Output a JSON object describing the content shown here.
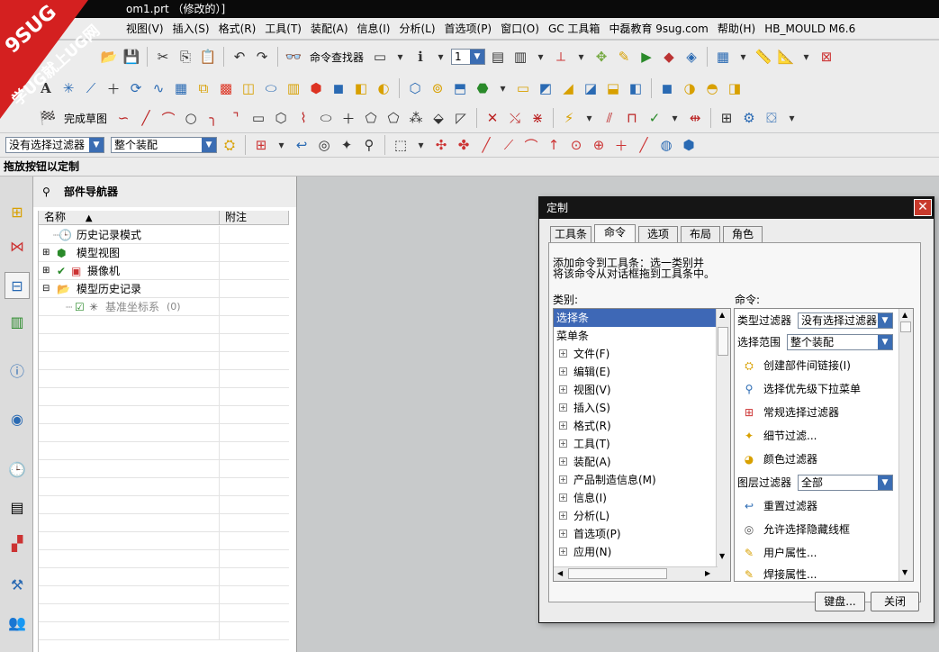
{
  "window": {
    "title": "om1.prt （修改的）]"
  },
  "menu": [
    "视图(V)",
    "插入(S)",
    "格式(R)",
    "工具(T)",
    "装配(A)",
    "信息(I)",
    "分析(L)",
    "首选项(P)",
    "窗口(O)",
    "GC 工具箱",
    "中磊教育 9sug.com",
    "帮助(H)",
    "HB_MOULD M6.6"
  ],
  "toolbar": {
    "command_finder": "命令查找器",
    "layer_value": "1",
    "finish_sketch": "完成草图",
    "filter_value": "没有选择过滤器",
    "assembly_value": "整个装配"
  },
  "hint": "拖放按钮以定制",
  "navigator": {
    "title": "部件导航器",
    "col_name": "名称",
    "col_note": "附注",
    "items": [
      {
        "label": "历史记录模式",
        "icon": "clock-icon"
      },
      {
        "label": "模型视图",
        "icon": "cube-icon"
      },
      {
        "label": "摄像机",
        "icon": "camera-icon"
      },
      {
        "label": "模型历史记录",
        "icon": "folder-icon"
      },
      {
        "label": "基准坐标系",
        "suffix": "(0)",
        "icon": "datum-csys-icon"
      }
    ]
  },
  "dialog": {
    "title": "定制",
    "tabs": [
      "工具条",
      "命令",
      "选项",
      "布局",
      "角色"
    ],
    "active_tab": 1,
    "instruction_line1": "添加命令到工具条：选一类别并",
    "instruction_line2": "将该命令从对话框拖到工具条中。",
    "category_label": "类别:",
    "command_label": "命令:",
    "categories": [
      "选择条",
      "菜单条",
      "文件(F)",
      "编辑(E)",
      "视图(V)",
      "插入(S)",
      "格式(R)",
      "工具(T)",
      "装配(A)",
      "产品制造信息(M)",
      "信息(I)",
      "分析(L)",
      "首选项(P)",
      "应用(N)"
    ],
    "commands": {
      "type_filter_label": "类型过滤器",
      "type_filter_value": "没有选择过滤器",
      "scope_label": "选择范围",
      "scope_value": "整个装配",
      "items": [
        "创建部件间链接(I)",
        "选择优先级下拉菜单",
        "常规选择过滤器",
        "细节过滤...",
        "颜色过滤器"
      ],
      "layer_filter_label": "图层过滤器",
      "layer_filter_value": "全部",
      "items2": [
        "重置过滤器",
        "允许选择隐藏线框",
        "用户属性...",
        "焊接属性..."
      ]
    },
    "keyboard_button": "键盘...",
    "close_button": "关闭"
  },
  "watermark": {
    "line1": "9SUG",
    "line2": "学UG就上UG网"
  },
  "colors": {
    "accent": "#3e68b6",
    "close_red": "#c83a2c",
    "titlebar": "#0a0a0a"
  }
}
